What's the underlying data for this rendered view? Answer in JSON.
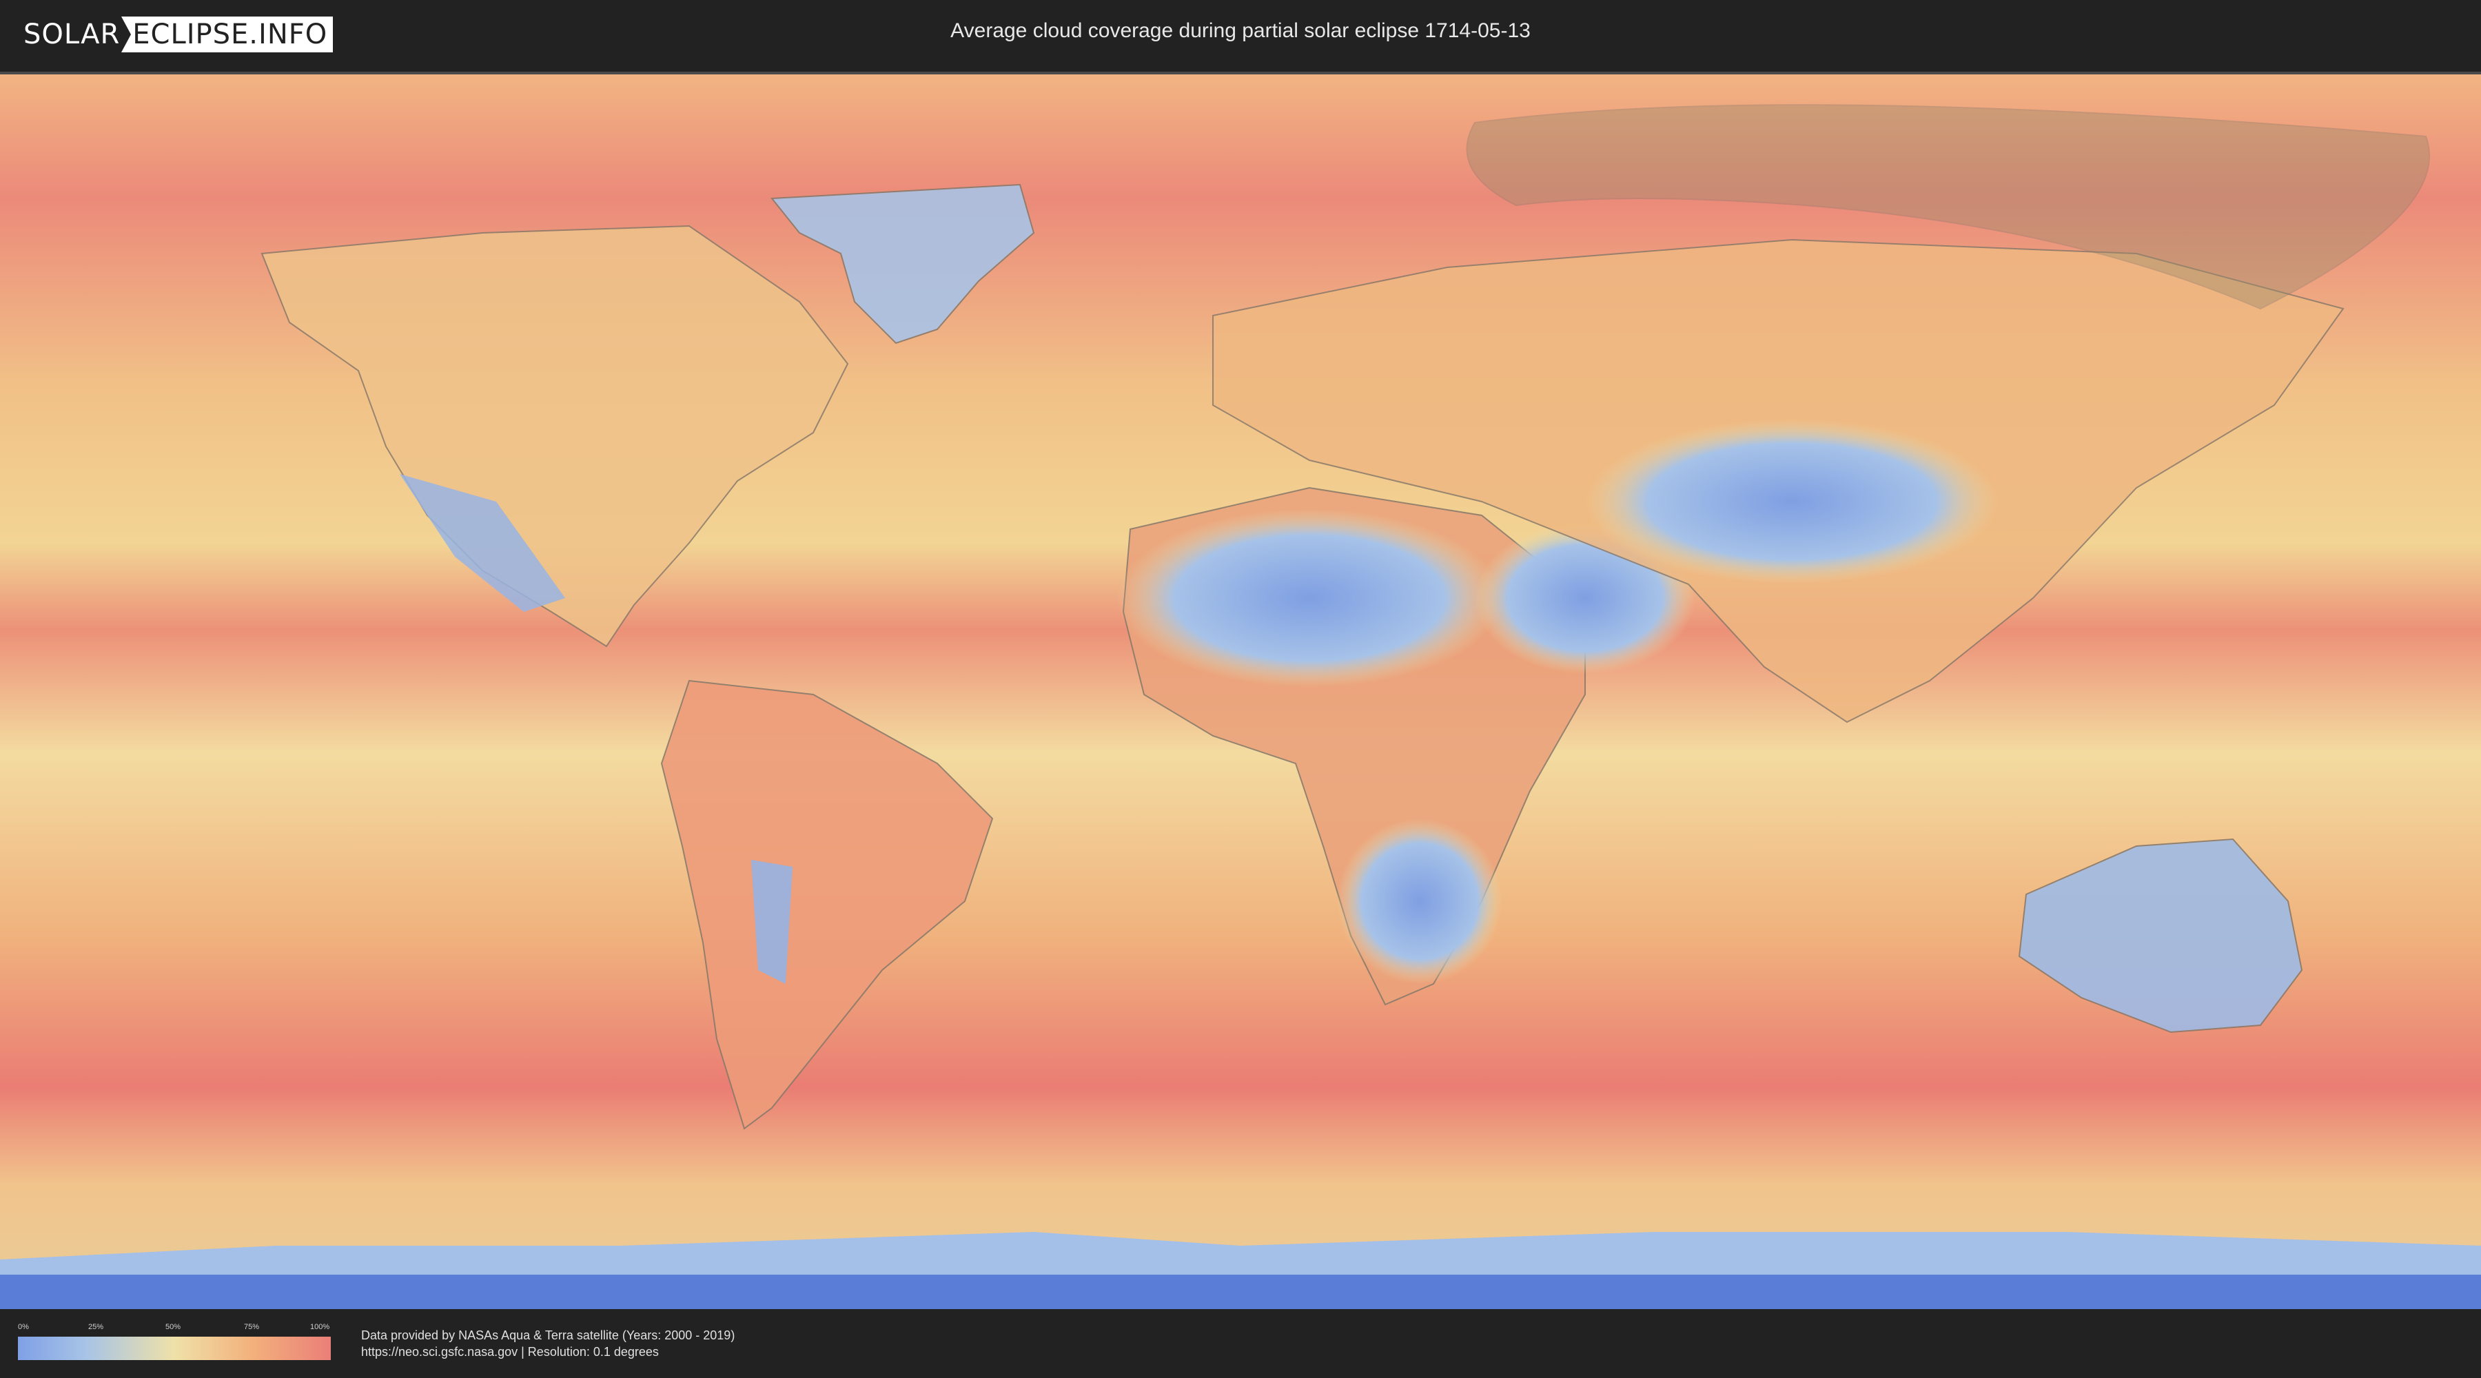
{
  "header": {
    "logo_part1": "SOLAR",
    "logo_part2": "ECLIPSE.INFO",
    "title": "Average cloud coverage during partial solar eclipse 1714-05-13"
  },
  "legend": {
    "ticks": [
      "0%",
      "25%",
      "50%",
      "75%",
      "100%"
    ],
    "colors": [
      "#7fa0e6",
      "#a8c4e6",
      "#efe1a8",
      "#f3b07c",
      "#ea7f78"
    ]
  },
  "footer": {
    "credit_line1": "Data provided by NASAs Aqua & Terra satellite (Years: 2000 - 2019)",
    "credit_line2": "https://neo.sci.gsfc.nasa.gov | Resolution: 0.1 degrees"
  },
  "map": {
    "ocean_color": "#f2ad80",
    "cloudy_color": "#eb8478",
    "clear_color": "#8fb0e6",
    "mid_color": "#efd9a0",
    "eclipse_zone_color": "#9a8a6a"
  }
}
